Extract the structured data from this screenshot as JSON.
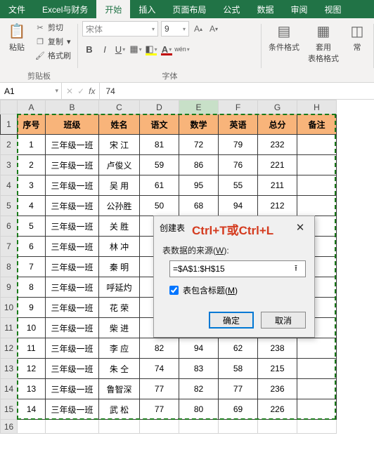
{
  "tabs": [
    "文件",
    "Excel与财务",
    "开始",
    "插入",
    "页面布局",
    "公式",
    "数据",
    "审阅",
    "视图"
  ],
  "active_tab_index": 2,
  "ribbon": {
    "clipboard": {
      "paste": "粘贴",
      "cut": "剪切",
      "copy": "复制",
      "painter": "格式刷",
      "group": "剪贴板"
    },
    "font": {
      "name": "宋体",
      "size": "9",
      "group": "字体"
    },
    "styles": {
      "cond": "条件格式",
      "table": "套用\n表格格式",
      "group": "常"
    }
  },
  "namebox": "A1",
  "formula": "74",
  "cols": [
    "A",
    "B",
    "C",
    "D",
    "E",
    "F",
    "G",
    "H"
  ],
  "headers": [
    "序号",
    "班级",
    "姓名",
    "语文",
    "数学",
    "英语",
    "总分",
    "备注"
  ],
  "rows": [
    [
      "1",
      "三年级一班",
      "宋  江",
      "81",
      "72",
      "79",
      "232",
      ""
    ],
    [
      "2",
      "三年级一班",
      "卢俊义",
      "59",
      "86",
      "76",
      "221",
      ""
    ],
    [
      "3",
      "三年级一班",
      "吴  用",
      "61",
      "95",
      "55",
      "211",
      ""
    ],
    [
      "4",
      "三年级一班",
      "公孙胜",
      "50",
      "68",
      "94",
      "212",
      ""
    ],
    [
      "5",
      "三年级一班",
      "关  胜",
      "",
      "",
      "",
      "",
      ""
    ],
    [
      "6",
      "三年级一班",
      "林  冲",
      "",
      "",
      "",
      "",
      ""
    ],
    [
      "7",
      "三年级一班",
      "秦  明",
      "",
      "",
      "",
      "",
      ""
    ],
    [
      "8",
      "三年级一班",
      "呼延灼",
      "",
      "",
      "",
      "",
      ""
    ],
    [
      "9",
      "三年级一班",
      "花  荣",
      "",
      "",
      "",
      "",
      ""
    ],
    [
      "10",
      "三年级一班",
      "柴  进",
      "",
      "",
      "",
      "",
      ""
    ],
    [
      "11",
      "三年级一班",
      "李  应",
      "82",
      "94",
      "62",
      "238",
      ""
    ],
    [
      "12",
      "三年级一班",
      "朱  仝",
      "74",
      "83",
      "58",
      "215",
      ""
    ],
    [
      "13",
      "三年级一班",
      "鲁智深",
      "77",
      "82",
      "77",
      "236",
      ""
    ],
    [
      "14",
      "三年级一班",
      "武  松",
      "77",
      "80",
      "69",
      "226",
      ""
    ]
  ],
  "dialog": {
    "title": "创建表",
    "src_label_pre": "表数据的来源(",
    "src_label_acc": "W",
    "src_label_post": "):",
    "range": "=$A$1:$H$15",
    "chk_pre": "表包含标题(",
    "chk_acc": "M",
    "chk_post": ")",
    "chk_checked": true,
    "ok": "确定",
    "cancel": "取消"
  },
  "annotation": "Ctrl+T或Ctrl+L"
}
